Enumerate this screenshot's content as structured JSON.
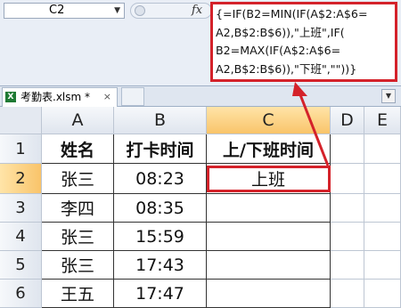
{
  "formula_bar": {
    "name_box": "C2",
    "fx_label": "fx",
    "formula_lines": [
      "{=IF(B2=MIN(IF(A$2:A$6=",
      "A2,B$2:B$6)),\"上班\",IF(",
      "B2=MAX(IF(A$2:A$6=",
      "A2,B$2:B$6)),\"下班\",\"\"))}"
    ]
  },
  "tab": {
    "icon": "excel-file-icon",
    "label": "考勤表.xlsm *",
    "close": "×",
    "menu_arrow": "▼"
  },
  "columns": [
    "A",
    "B",
    "C",
    "D",
    "E"
  ],
  "rows": [
    "1",
    "2",
    "3",
    "4",
    "5",
    "6"
  ],
  "headers": {
    "a": "姓名",
    "b": "打卡时间",
    "c": "上/下班时间"
  },
  "data": [
    {
      "a": "张三",
      "b": "08:23",
      "c": "上班"
    },
    {
      "a": "李四",
      "b": "08:35",
      "c": ""
    },
    {
      "a": "张三",
      "b": "15:59",
      "c": ""
    },
    {
      "a": "张三",
      "b": "17:43",
      "c": ""
    },
    {
      "a": "王五",
      "b": "17:47",
      "c": ""
    }
  ],
  "selected_cell": "C2",
  "highlight_color": "#d4222a"
}
